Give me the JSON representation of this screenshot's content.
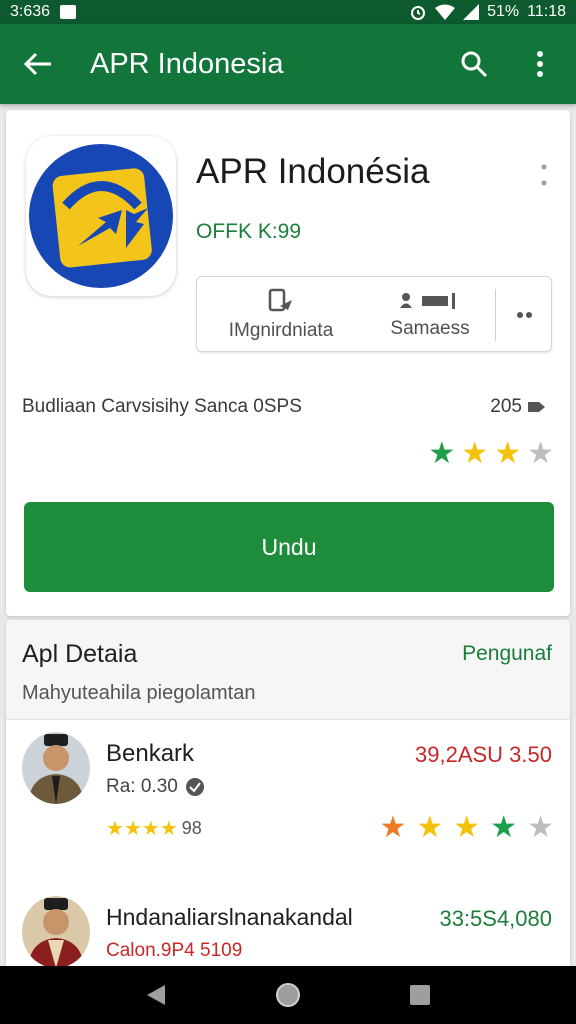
{
  "status_bar": {
    "left_text": "3:636",
    "battery": "51%",
    "time": "11:18"
  },
  "app_bar": {
    "title": "APR Indonesia"
  },
  "app": {
    "name": "APR Indonésia",
    "offer": "OFFK K:99",
    "actions": [
      {
        "label": "IMgnirdniata",
        "icon": "phone-icon"
      },
      {
        "label": "Samaess",
        "icon": "people-icon"
      }
    ],
    "stats_text": "Budliaan Carvsisihy Sanca 0SPS",
    "stats_count": "205",
    "rating_stars": 3,
    "install_label": "Undu"
  },
  "details": {
    "title": "Apl Detaia",
    "link": "Pengunaf",
    "subtitle": "Mahyuteahila piegolamtan"
  },
  "reviews": [
    {
      "name": "Benkark",
      "price": "39,2ASU  3.50",
      "meta": "Ra: 0.30",
      "small_stars": 4,
      "small_count": "98",
      "big_stars": 4
    },
    {
      "name": "Hndanaliarslnanakandal",
      "price": "33:5S4,080",
      "meta": "Calon.9P4  5109"
    }
  ],
  "colors": {
    "status_bar": "#0d5a2e",
    "app_bar": "#12763a",
    "accent": "#1d8d3b",
    "star_yellow": "#f4c20d",
    "star_green": "#1e9e4a",
    "star_orange": "#f07a24",
    "price_red": "#c62828"
  }
}
